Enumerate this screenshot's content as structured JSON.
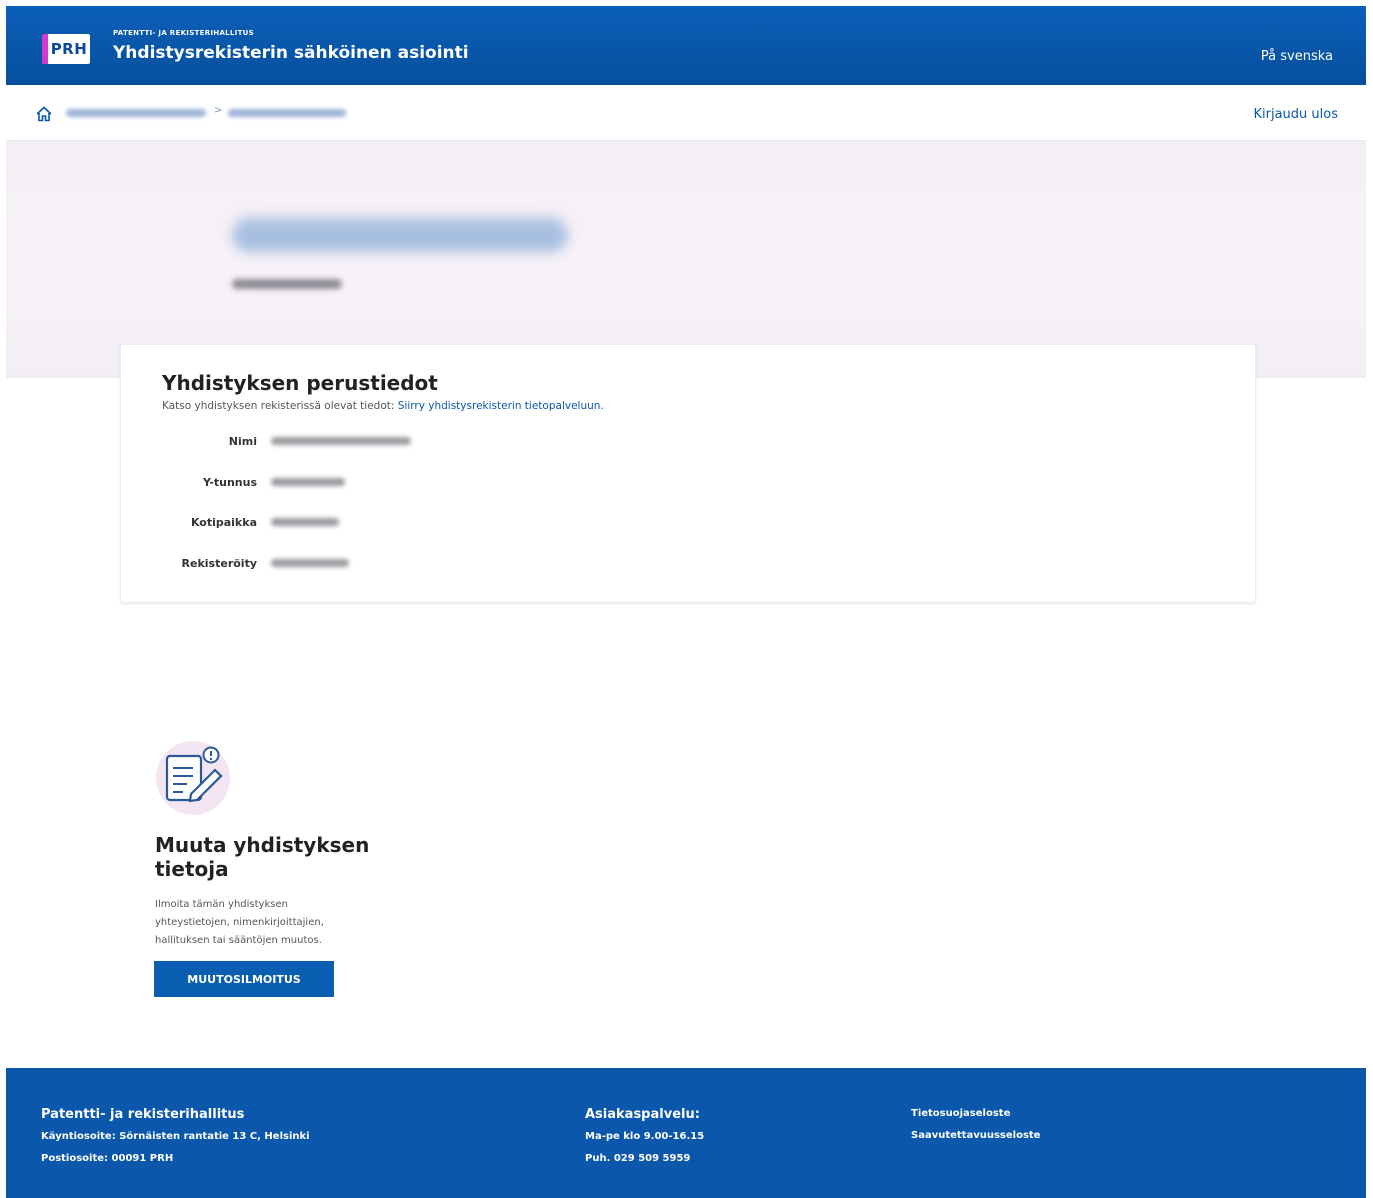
{
  "header": {
    "logo_text": "PRH",
    "org_small": "PATENTTI- JA REKISTERIHALLITUS",
    "title": "Yhdistysrekisterin sähköinen asiointi",
    "language_link": "På svenska"
  },
  "breadcrumb": {
    "separator": ">",
    "logout": "Kirjaudu ulos"
  },
  "info": {
    "title": "Yhdistyksen perustiedot",
    "description": "Katso yhdistyksen rekisterissä olevat tiedot:",
    "link_text": "Siirry yhdistysrekisterin tietopalveluun.",
    "fields": [
      {
        "label": "Nimi"
      },
      {
        "label": "Y-tunnus"
      },
      {
        "label": "Kotipaikka"
      },
      {
        "label": "Rekisteröity"
      }
    ]
  },
  "change": {
    "title": "Muuta yhdistyksen tietoja",
    "description": "Ilmoita tämän yhdistyksen yhteystietojen, nimenkirjoittajien, hallituksen tai sääntöjen muutos.",
    "button_label": "MUUTOSILMOITUS"
  },
  "footer": {
    "org_name": "Patentti- ja rekisterihallitus",
    "visit_address": "Käyntiosoite: Sörnäisten rantatie 13 C, Helsinki",
    "postal_address": "Postiosoite: 00091 PRH",
    "service_title": "Asiakaspalvelu:",
    "service_hours": "Ma-pe klo 9.00-16.15",
    "service_phone": "Puh. 029 509 5959",
    "privacy_link": "Tietosuojaseloste",
    "accessibility_link": "Saavutettavuusseloste"
  }
}
